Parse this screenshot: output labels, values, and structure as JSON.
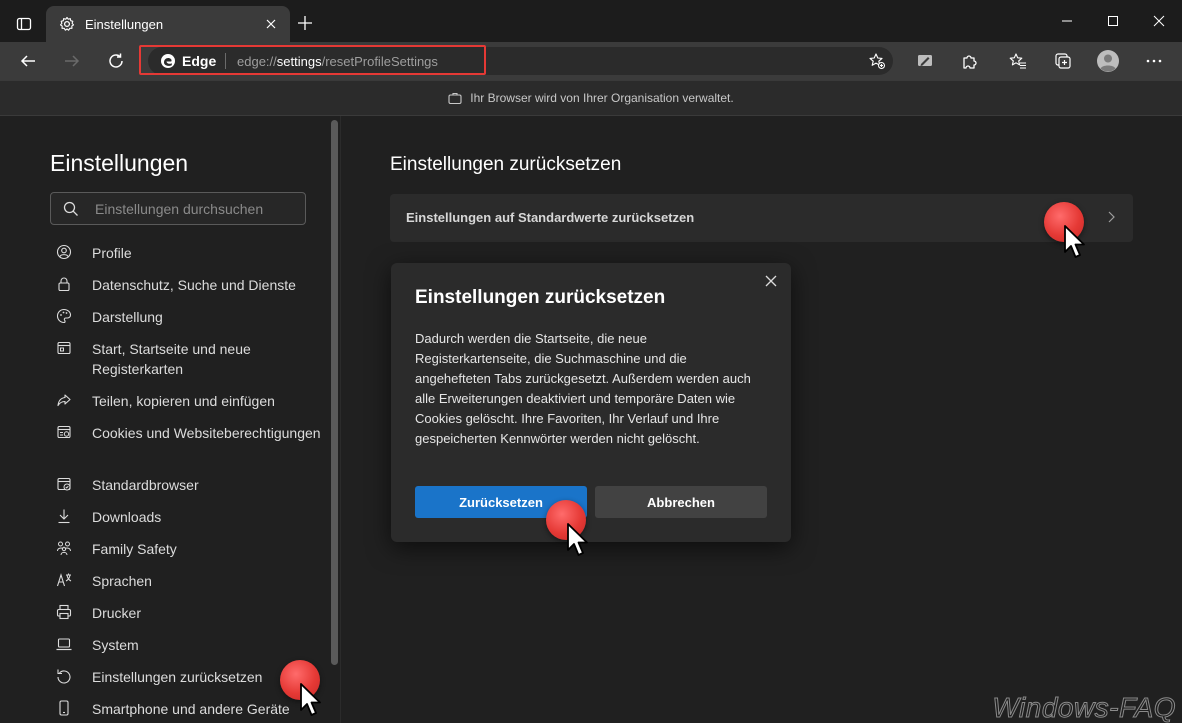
{
  "window": {
    "tab_title": "Einstellungen",
    "tab_icon": "gear-icon"
  },
  "toolbar": {
    "edge_label": "Edge",
    "url_prefix": "edge://",
    "url_strong": "settings",
    "url_suffix": "/resetProfileSettings"
  },
  "infobar": {
    "text": "Ihr Browser wird von Ihrer Organisation verwaltet."
  },
  "sidebar": {
    "title": "Einstellungen",
    "search_placeholder": "Einstellungen durchsuchen",
    "items": [
      {
        "label": "Profile",
        "icon": "profile-icon"
      },
      {
        "label": "Datenschutz, Suche und Dienste",
        "icon": "lock-icon"
      },
      {
        "label": "Darstellung",
        "icon": "palette-icon"
      },
      {
        "label": "Start, Startseite und neue Registerkarten",
        "icon": "home-icon"
      },
      {
        "label": "Teilen, kopieren und einfügen",
        "icon": "share-icon"
      },
      {
        "label": "Cookies und Websiteberechtigungen",
        "icon": "cookie-icon"
      },
      {
        "label": "Standardbrowser",
        "icon": "browser-icon"
      },
      {
        "label": "Downloads",
        "icon": "download-icon"
      },
      {
        "label": "Family Safety",
        "icon": "family-icon"
      },
      {
        "label": "Sprachen",
        "icon": "language-icon"
      },
      {
        "label": "Drucker",
        "icon": "printer-icon"
      },
      {
        "label": "System",
        "icon": "laptop-icon"
      },
      {
        "label": "Einstellungen zurücksetzen",
        "icon": "reset-icon"
      },
      {
        "label": "Smartphone und andere Geräte",
        "icon": "phone-icon"
      }
    ]
  },
  "main": {
    "title": "Einstellungen zurücksetzen",
    "row_label": "Einstellungen auf Standardwerte zurücksetzen"
  },
  "dialog": {
    "title": "Einstellungen zurücksetzen",
    "body": "Dadurch werden die Startseite, die neue Registerkartenseite, die Suchmaschine und die angehefteten Tabs zurückgesetzt. Außerdem werden auch alle Erweiterungen deaktiviert und temporäre Daten wie Cookies gelöscht. Ihre Favoriten, Ihr Verlauf und Ihre gespeicherten Kennwörter werden nicht gelöscht.",
    "confirm_label": "Zurücksetzen",
    "cancel_label": "Abbrechen"
  },
  "watermark": "Windows-FAQ",
  "colors": {
    "accent": "#1a74c9",
    "highlight": "#e53935",
    "background": "#202020"
  }
}
